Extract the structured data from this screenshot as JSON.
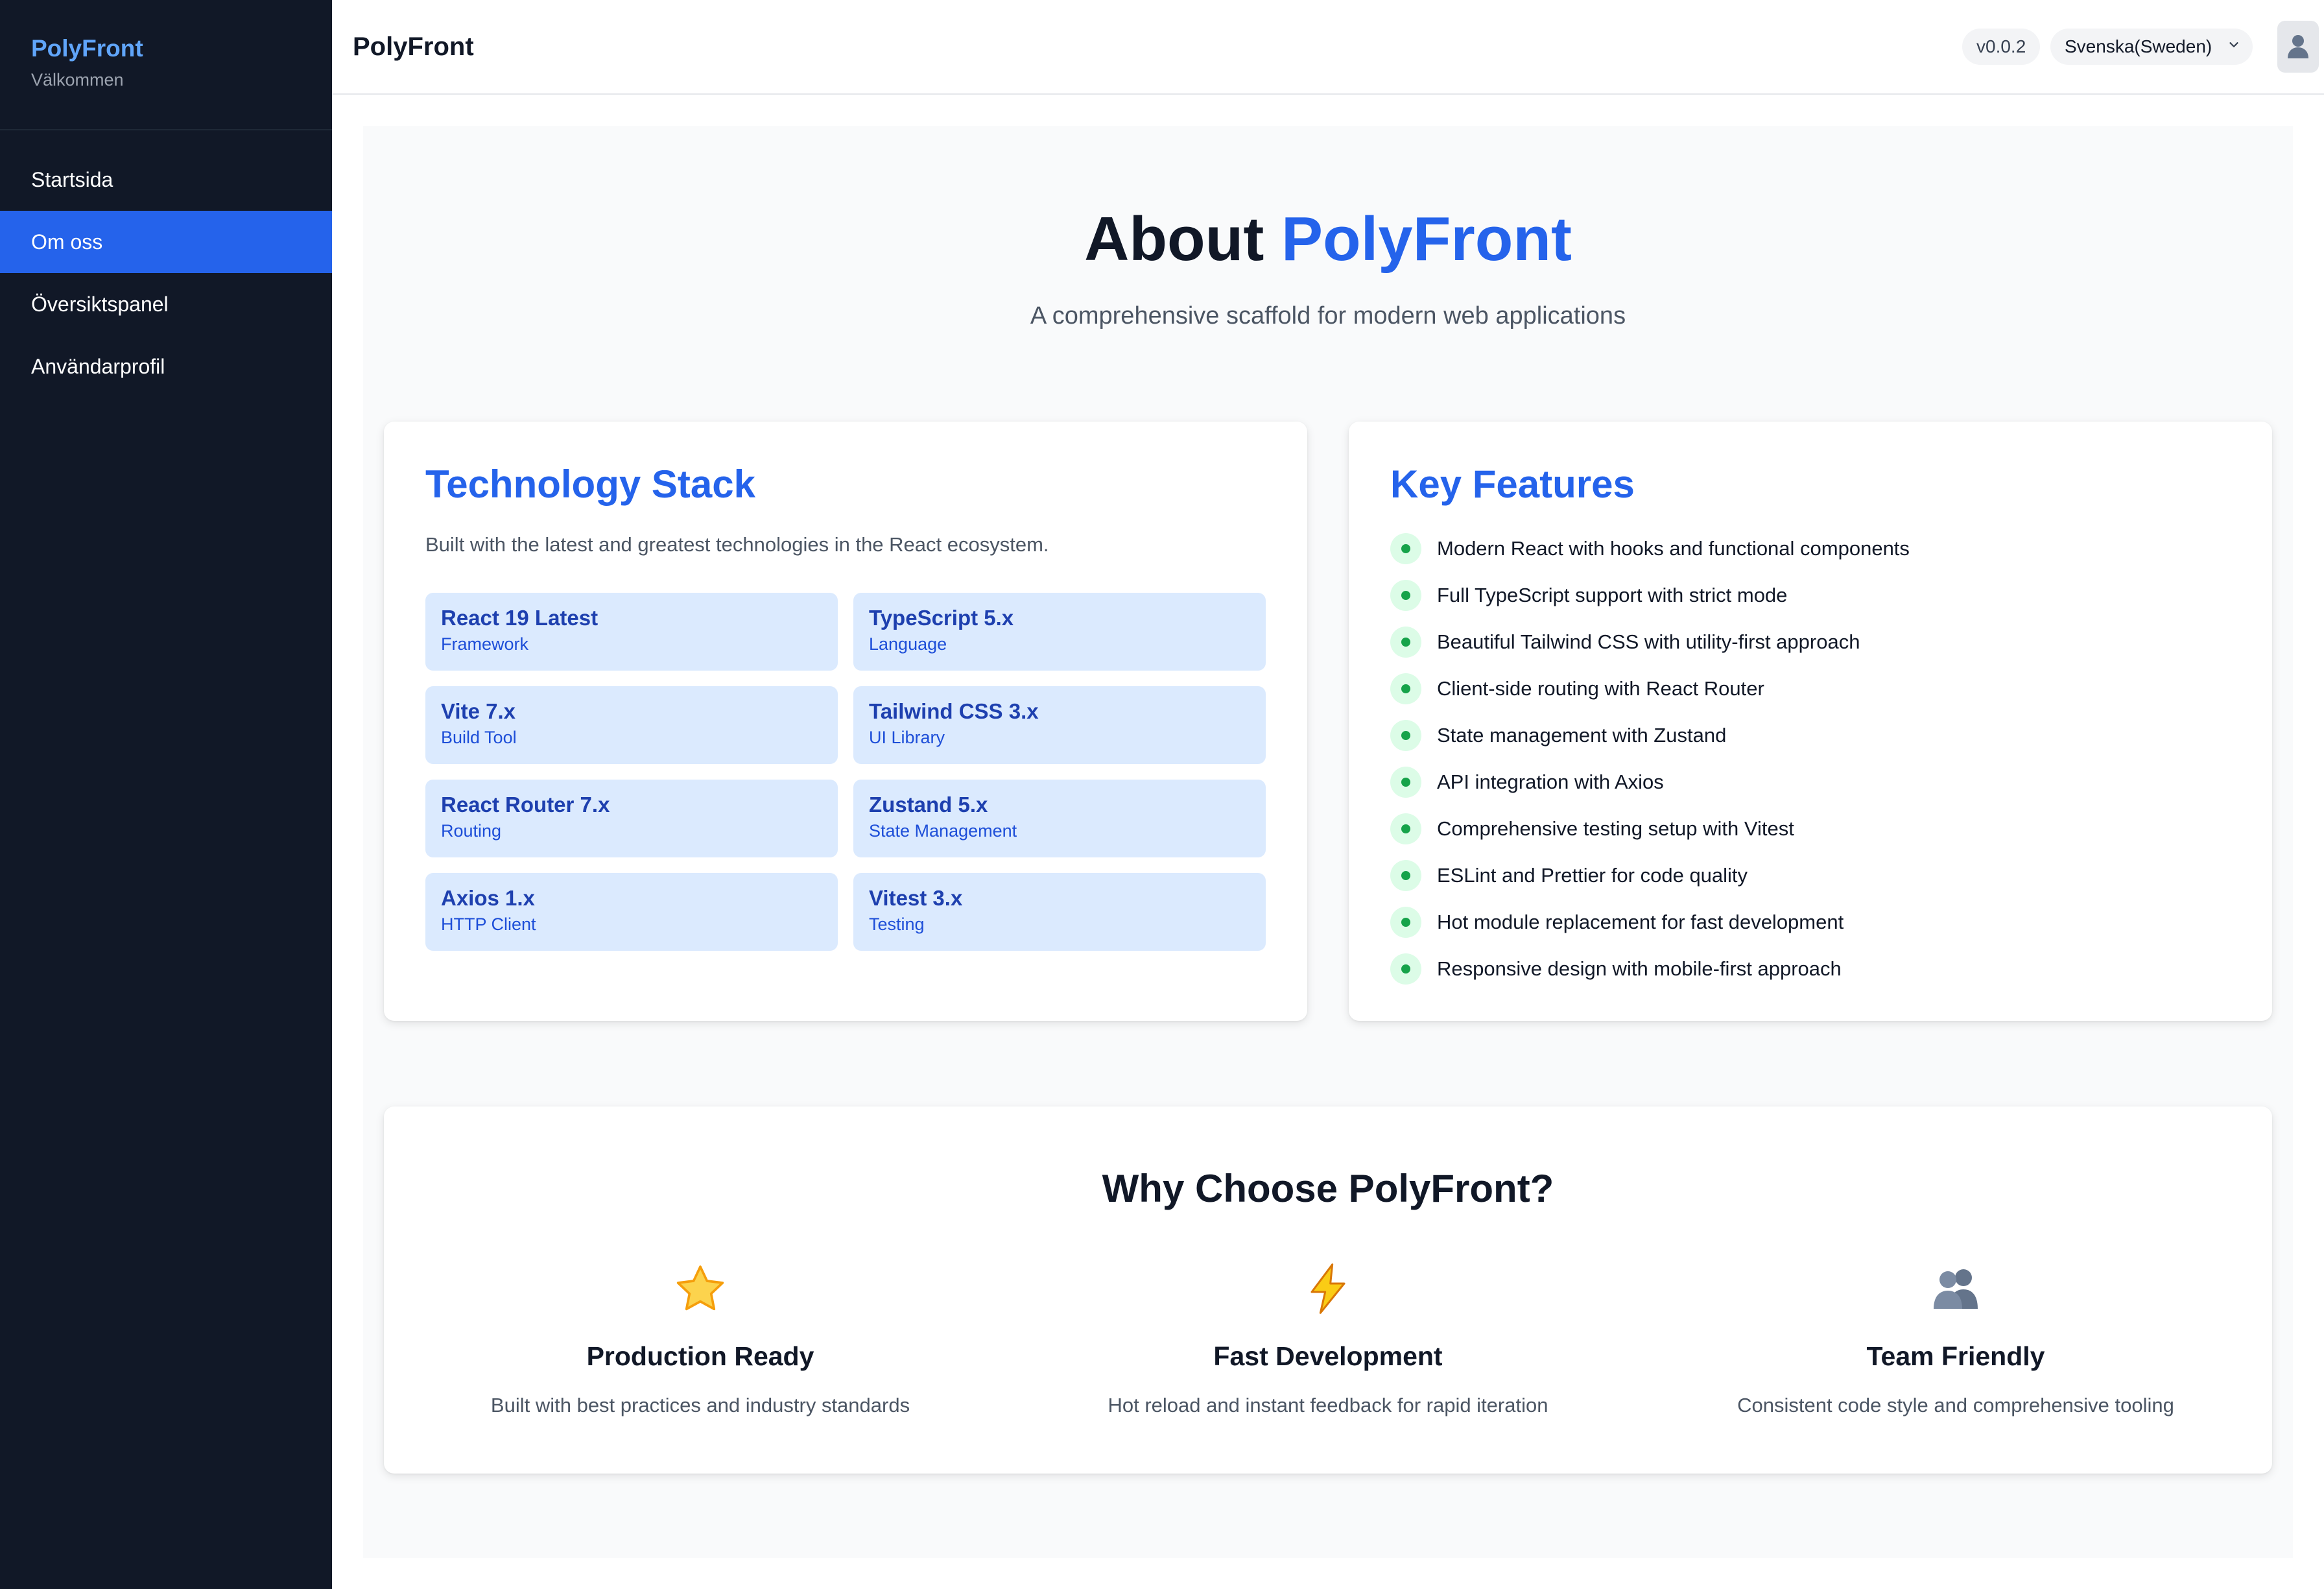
{
  "sidebar": {
    "brand": "PolyFront",
    "subtitle": "Välkommen",
    "items": [
      {
        "label": "Startsida",
        "active": false
      },
      {
        "label": "Om oss",
        "active": true
      },
      {
        "label": "Översiktspanel",
        "active": false
      },
      {
        "label": "Användarprofil",
        "active": false
      }
    ]
  },
  "header": {
    "title": "PolyFront",
    "version": "v0.0.2",
    "language": "Svenska(Sweden)",
    "avatar_icon": "user-icon"
  },
  "hero": {
    "title_prefix": "About",
    "title_accent": "PolyFront",
    "subtitle": "A comprehensive scaffold for modern web applications"
  },
  "tech": {
    "title": "Technology Stack",
    "description": "Built with the latest and greatest technologies in the React ecosystem.",
    "items": [
      {
        "name": "React 19 Latest",
        "category": "Framework"
      },
      {
        "name": "TypeScript 5.x",
        "category": "Language"
      },
      {
        "name": "Vite 7.x",
        "category": "Build Tool"
      },
      {
        "name": "Tailwind CSS 3.x",
        "category": "UI Library"
      },
      {
        "name": "React Router 7.x",
        "category": "Routing"
      },
      {
        "name": "Zustand 5.x",
        "category": "State Management"
      },
      {
        "name": "Axios 1.x",
        "category": "HTTP Client"
      },
      {
        "name": "Vitest 3.x",
        "category": "Testing"
      }
    ]
  },
  "features": {
    "title": "Key Features",
    "items": [
      "Modern React with hooks and functional components",
      "Full TypeScript support with strict mode",
      "Beautiful Tailwind CSS with utility-first approach",
      "Client-side routing with React Router",
      "State management with Zustand",
      "API integration with Axios",
      "Comprehensive testing setup with Vitest",
      "ESLint and Prettier for code quality",
      "Hot module replacement for fast development",
      "Responsive design with mobile-first approach"
    ]
  },
  "why": {
    "title": "Why Choose PolyFront?",
    "columns": [
      {
        "icon": "star-icon",
        "title": "Production Ready",
        "text": "Built with best practices and industry standards"
      },
      {
        "icon": "lightning-icon",
        "title": "Fast Development",
        "text": "Hot reload and instant feedback for rapid iteration"
      },
      {
        "icon": "people-icon",
        "title": "Team Friendly",
        "text": "Consistent code style and comprehensive tooling"
      }
    ]
  },
  "colors": {
    "sidebar_bg": "#111827",
    "accent": "#2563eb",
    "brand": "#60a5fa",
    "tech_tile_bg": "#dbeafe",
    "feature_dot": "#16a34a",
    "feature_dot_bg": "#dcfce7",
    "main_bg": "#f9fafb"
  }
}
